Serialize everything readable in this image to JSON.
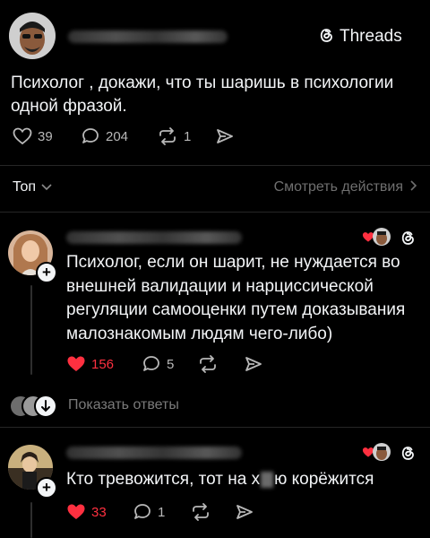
{
  "brand": {
    "name": "Threads"
  },
  "post": {
    "text_line1": "Психолог , докажи, что ты шаришь в психологии",
    "text_line2": "одной фразой.",
    "likes": "39",
    "comments": "204",
    "reposts": "1"
  },
  "sort": {
    "label": "Топ",
    "activity_link": "Смотреть действия"
  },
  "replies": [
    {
      "lines": [
        "Психолог, если он шарит, не нуждается во",
        "внешней валидации и нарциссической",
        "регуляции самооценки путем доказывания",
        "малознакомым людям чего-либо)"
      ],
      "likes": "156",
      "comments": "5",
      "show_replies": "Показать ответы"
    },
    {
      "line_before": "Кто тревожится, тот на х",
      "line_after": "ю корёжится",
      "likes": "33",
      "comments": "1"
    }
  ],
  "colors": {
    "like_red": "#ff3040",
    "muted": "#8a8a8a",
    "text": "#f3f5f7"
  }
}
